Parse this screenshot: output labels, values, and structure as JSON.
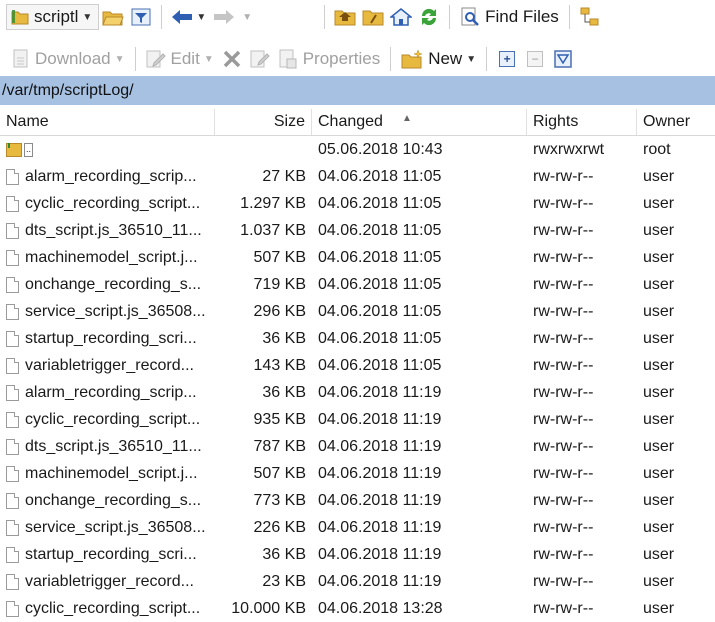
{
  "toolbar1": {
    "location_dropdown": "scriptl",
    "find_files_label": "Find Files"
  },
  "toolbar2": {
    "download_label": "Download",
    "edit_label": "Edit",
    "properties_label": "Properties",
    "new_label": "New"
  },
  "path": "/var/tmp/scriptLog/",
  "columns": {
    "name": "Name",
    "size": "Size",
    "changed": "Changed",
    "rights": "Rights",
    "owner": "Owner"
  },
  "parent_row": {
    "name": "..",
    "changed": "05.06.2018 10:43",
    "rights": "rwxrwxrwt",
    "owner": "root"
  },
  "files": [
    {
      "name": "alarm_recording_scrip...",
      "size": "27 KB",
      "changed": "04.06.2018 11:05",
      "rights": "rw-rw-r--",
      "owner": "user"
    },
    {
      "name": "cyclic_recording_script...",
      "size": "1.297 KB",
      "changed": "04.06.2018 11:05",
      "rights": "rw-rw-r--",
      "owner": "user"
    },
    {
      "name": "dts_script.js_36510_11...",
      "size": "1.037 KB",
      "changed": "04.06.2018 11:05",
      "rights": "rw-rw-r--",
      "owner": "user"
    },
    {
      "name": "machinemodel_script.j...",
      "size": "507 KB",
      "changed": "04.06.2018 11:05",
      "rights": "rw-rw-r--",
      "owner": "user"
    },
    {
      "name": "onchange_recording_s...",
      "size": "719 KB",
      "changed": "04.06.2018 11:05",
      "rights": "rw-rw-r--",
      "owner": "user"
    },
    {
      "name": "service_script.js_36508...",
      "size": "296 KB",
      "changed": "04.06.2018 11:05",
      "rights": "rw-rw-r--",
      "owner": "user"
    },
    {
      "name": "startup_recording_scri...",
      "size": "36 KB",
      "changed": "04.06.2018 11:05",
      "rights": "rw-rw-r--",
      "owner": "user"
    },
    {
      "name": "variabletrigger_record...",
      "size": "143 KB",
      "changed": "04.06.2018 11:05",
      "rights": "rw-rw-r--",
      "owner": "user"
    },
    {
      "name": "alarm_recording_scrip...",
      "size": "36 KB",
      "changed": "04.06.2018 11:19",
      "rights": "rw-rw-r--",
      "owner": "user"
    },
    {
      "name": "cyclic_recording_script...",
      "size": "935 KB",
      "changed": "04.06.2018 11:19",
      "rights": "rw-rw-r--",
      "owner": "user"
    },
    {
      "name": "dts_script.js_36510_11...",
      "size": "787 KB",
      "changed": "04.06.2018 11:19",
      "rights": "rw-rw-r--",
      "owner": "user"
    },
    {
      "name": "machinemodel_script.j...",
      "size": "507 KB",
      "changed": "04.06.2018 11:19",
      "rights": "rw-rw-r--",
      "owner": "user"
    },
    {
      "name": "onchange_recording_s...",
      "size": "773 KB",
      "changed": "04.06.2018 11:19",
      "rights": "rw-rw-r--",
      "owner": "user"
    },
    {
      "name": "service_script.js_36508...",
      "size": "226 KB",
      "changed": "04.06.2018 11:19",
      "rights": "rw-rw-r--",
      "owner": "user"
    },
    {
      "name": "startup_recording_scri...",
      "size": "36 KB",
      "changed": "04.06.2018 11:19",
      "rights": "rw-rw-r--",
      "owner": "user"
    },
    {
      "name": "variabletrigger_record...",
      "size": "23 KB",
      "changed": "04.06.2018 11:19",
      "rights": "rw-rw-r--",
      "owner": "user"
    },
    {
      "name": "cyclic_recording_script...",
      "size": "10.000 KB",
      "changed": "04.06.2018 13:28",
      "rights": "rw-rw-r--",
      "owner": "user"
    }
  ],
  "icons": {
    "folder": "folder-icon",
    "open_folder": "open-folder-icon",
    "filter": "filter-icon",
    "back": "back-arrow-icon",
    "forward": "forward-arrow-icon",
    "root": "root-folder-icon",
    "home": "home-icon",
    "refresh": "refresh-icon",
    "find": "find-files-icon",
    "tree": "tree-toggle-icon",
    "file": "file-icon"
  },
  "colors": {
    "path_bar": "#a6c1e2",
    "selection": "#cde3f7",
    "folder": "#e7b93f",
    "nav_blue": "#2f5fb3",
    "refresh_green": "#3aa33a"
  }
}
